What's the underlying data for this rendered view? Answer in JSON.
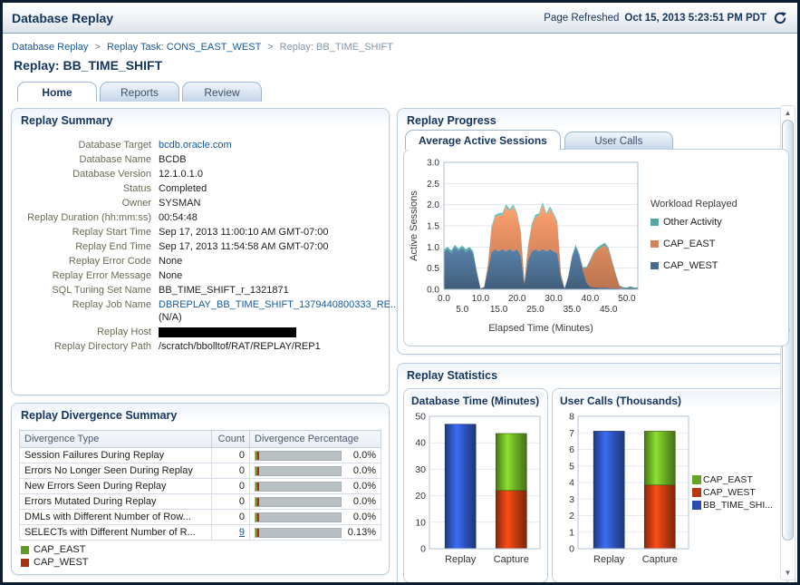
{
  "header": {
    "title": "Database Replay",
    "page_refreshed_label": "Page Refreshed",
    "page_refreshed_time": "Oct 15, 2013 5:23:51 PM PDT"
  },
  "breadcrumb": {
    "separator": ">",
    "items": [
      {
        "label": "Database Replay"
      },
      {
        "label": "Replay Task: CONS_EAST_WEST"
      },
      {
        "label": "Replay: BB_TIME_SHIFT"
      }
    ]
  },
  "page_title": "Replay: BB_TIME_SHIFT",
  "tabs": [
    {
      "label": "Home"
    },
    {
      "label": "Reports"
    },
    {
      "label": "Review"
    }
  ],
  "replay_summary": {
    "title": "Replay Summary",
    "fields": [
      {
        "label": "Database Target",
        "value": "bcdb.oracle.com"
      },
      {
        "label": "Database Name",
        "value": "BCDB"
      },
      {
        "label": "Database Version",
        "value": "12.1.0.1.0"
      },
      {
        "label": "Status",
        "value": "Completed"
      },
      {
        "label": "Owner",
        "value": "SYSMAN"
      },
      {
        "label": "Replay Duration (hh:mm:ss)",
        "value": "00:54:48"
      },
      {
        "label": "Replay Start Time",
        "value": "Sep 17, 2013 11:00:10 AM GMT-07:00"
      },
      {
        "label": "Replay End Time",
        "value": "Sep 17, 2013 11:54:58 AM GMT-07:00"
      },
      {
        "label": "Replay Error Code",
        "value": "None"
      },
      {
        "label": "Replay Error Message",
        "value": "None"
      },
      {
        "label": "SQL Tuning Set Name",
        "value": "BB_TIME_SHIFT_r_1321871"
      },
      {
        "label": "Replay Job Name",
        "value": "DBREPLAY_BB_TIME_SHIFT_1379440800333_RE...",
        "suffix": "(N/A)"
      },
      {
        "label": "Replay Host",
        "value": ""
      },
      {
        "label": "Replay Directory Path",
        "value": "/scratch/bbolltof/RAT/REPLAY/REP1"
      }
    ]
  },
  "divergence": {
    "title": "Replay Divergence Summary",
    "columns": [
      "Divergence Type",
      "Count",
      "Divergence Percentage"
    ],
    "rows": [
      {
        "type": "Session Failures During Replay",
        "count": "0",
        "pct": "0.0%"
      },
      {
        "type": "Errors No Longer Seen During Replay",
        "count": "0",
        "pct": "0.0%"
      },
      {
        "type": "New Errors Seen During Replay",
        "count": "0",
        "pct": "0.0%"
      },
      {
        "type": "Errors Mutated During Replay",
        "count": "0",
        "pct": "0.0%"
      },
      {
        "type": "DMLs with Different Number of Row...",
        "count": "0",
        "pct": "0.0%"
      },
      {
        "type": "SELECTs with Different Number of R...",
        "count": "9",
        "pct": "0.13%"
      }
    ],
    "legend": [
      {
        "label": "CAP_EAST",
        "color": "#5f9c1f"
      },
      {
        "label": "CAP_WEST",
        "color": "#a93112"
      }
    ]
  },
  "replay_progress": {
    "title": "Replay Progress",
    "tabs": [
      {
        "label": "Average Active Sessions"
      },
      {
        "label": "User Calls"
      }
    ]
  },
  "replay_statistics": {
    "title": "Replay Statistics"
  },
  "icons": {
    "scroll_up": "▲",
    "scroll_down": "▼",
    "thumb_grip": "≡"
  },
  "chart_data": [
    {
      "type": "area",
      "stacked": true,
      "title": "Average Active Sessions",
      "xlabel": "Elapsed Time (Minutes)",
      "ylabel": "Active Sessions",
      "ylim": [
        0,
        3
      ],
      "ytick": 0.5,
      "xticks": [
        0,
        5,
        10,
        15,
        20,
        25,
        30,
        35,
        40,
        45,
        50
      ],
      "legend_title": "Workload Replayed",
      "legend": [
        {
          "label": "Other Activity",
          "color": "#56a7a3"
        },
        {
          "label": "CAP_EAST",
          "color": "#d4845a"
        },
        {
          "label": "CAP_WEST",
          "color": "#4a6b8c"
        }
      ],
      "x": [
        0,
        1,
        2,
        3,
        4,
        5,
        6,
        7,
        8,
        9,
        10,
        11,
        12,
        13,
        14,
        15,
        16,
        17,
        18,
        19,
        20,
        21,
        22,
        23,
        24,
        25,
        26,
        27,
        28,
        29,
        30,
        31,
        32,
        33,
        34,
        35,
        36,
        37,
        38,
        39,
        40,
        41,
        42,
        43,
        44,
        45,
        46,
        47,
        48,
        49,
        50,
        51,
        52,
        53
      ],
      "series": [
        {
          "name": "CAP_WEST",
          "color": "#4a6b8c",
          "values": [
            0.88,
            0.95,
            0.85,
            1.0,
            0.9,
            0.98,
            0.88,
            0.95,
            0.85,
            0.4,
            0.02,
            0.05,
            0.45,
            0.88,
            0.95,
            0.9,
            0.95,
            0.9,
            0.95,
            0.9,
            0.95,
            0.8,
            0.12,
            0.7,
            0.9,
            0.95,
            0.9,
            0.95,
            0.9,
            0.95,
            0.9,
            0.85,
            0.25,
            0.02,
            0.3,
            0.75,
            1.0,
            0.8,
            0.45,
            0.15,
            0.06,
            0.05,
            0.04,
            0.04,
            0.04,
            0.03,
            0.03,
            0.03,
            0.02,
            0.02,
            0.02,
            0.03,
            0.02,
            0.02
          ]
        },
        {
          "name": "CAP_EAST",
          "color": "#d4845a",
          "values": [
            0,
            0,
            0,
            0,
            0,
            0,
            0,
            0,
            0,
            0,
            0,
            0,
            0.1,
            0.55,
            0.75,
            0.85,
            0.8,
            1.05,
            0.9,
            1.05,
            0.8,
            0.55,
            0.05,
            0.3,
            0.6,
            0.75,
            0.85,
            1.05,
            0.85,
            0.95,
            0.85,
            0.7,
            0.1,
            0,
            0,
            0,
            0,
            0,
            0.05,
            0.35,
            0.6,
            0.8,
            0.9,
            0.95,
            1.0,
            0.9,
            0.6,
            0.3,
            0.05,
            0,
            0,
            0,
            0,
            0
          ]
        },
        {
          "name": "Other Activity",
          "color": "#56a7a3",
          "values": [
            0.06,
            0.05,
            0.07,
            0.05,
            0.06,
            0.05,
            0.07,
            0.05,
            0.05,
            0.02,
            0.0,
            0.01,
            0.03,
            0.05,
            0.06,
            0.05,
            0.06,
            0.06,
            0.05,
            0.06,
            0.05,
            0.04,
            0.01,
            0.04,
            0.05,
            0.06,
            0.05,
            0.06,
            0.05,
            0.06,
            0.05,
            0.05,
            0.02,
            0.0,
            0.02,
            0.04,
            0.05,
            0.04,
            0.02,
            0.03,
            0.04,
            0.04,
            0.05,
            0.06,
            0.06,
            0.05,
            0.04,
            0.03,
            0.02,
            0.03,
            0.02,
            0.04,
            0.02,
            0.03
          ]
        }
      ]
    },
    {
      "type": "bar",
      "title": "Database Time (Minutes)",
      "categories": [
        "Replay",
        "Capture"
      ],
      "ylim": [
        0,
        50
      ],
      "ytick": 10,
      "series": [
        {
          "name": "BB_TIME_SHIFT",
          "color": "#2a4fb0",
          "values": [
            47,
            0
          ]
        },
        {
          "name": "CAP_WEST",
          "color": "#b8380f",
          "values": [
            0,
            22
          ]
        },
        {
          "name": "CAP_EAST",
          "color": "#66a423",
          "values": [
            0,
            21.5
          ]
        }
      ]
    },
    {
      "type": "bar",
      "title": "User Calls (Thousands)",
      "categories": [
        "Replay",
        "Capture"
      ],
      "ylim": [
        0,
        8
      ],
      "ytick": 1,
      "series": [
        {
          "name": "BB_TIME_SHIFT",
          "color": "#2a4fb0",
          "values": [
            7.1,
            0
          ]
        },
        {
          "name": "CAP_WEST",
          "color": "#b8380f",
          "values": [
            0,
            3.85
          ]
        },
        {
          "name": "CAP_EAST",
          "color": "#66a423",
          "values": [
            0,
            3.25
          ]
        }
      ],
      "legend": [
        {
          "label": "CAP_EAST",
          "color": "#66a423"
        },
        {
          "label": "CAP_WEST",
          "color": "#b8380f"
        },
        {
          "label": "BB_TIME_SHI...",
          "color": "#2a4fb0"
        }
      ]
    }
  ]
}
